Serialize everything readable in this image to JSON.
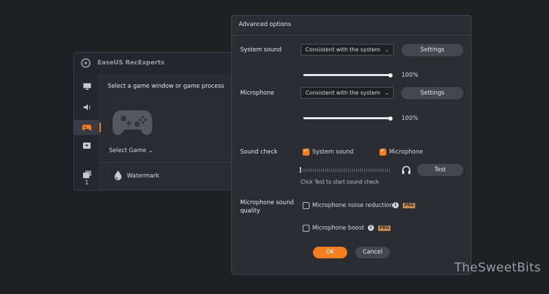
{
  "background_app": {
    "title": "EaseUS RecExperts",
    "heading": "Select a game window or game process",
    "select_game": "Select Game",
    "watermark_label": "Watermark",
    "rail_count": "1",
    "rail_icons": [
      "monitor-icon",
      "speaker-icon",
      "gamepad-icon",
      "dropdown-icon",
      "layers-icon"
    ]
  },
  "dialog": {
    "title": "Advanced options",
    "system_sound": {
      "label": "System sound",
      "select_value": "Consistent with the system",
      "settings_label": "Settings",
      "volume_pct": "100%",
      "volume": 100
    },
    "microphone": {
      "label": "Microphone",
      "select_value": "Consistent with the system",
      "settings_label": "Settings",
      "volume_pct": "100%",
      "volume": 100
    },
    "sound_check": {
      "label": "Sound check",
      "system_sound_label": "System sound",
      "system_sound_checked": true,
      "microphone_label": "Microphone",
      "microphone_checked": true,
      "test_label": "Test",
      "hint": "Click Test to start sound check"
    },
    "mic_quality": {
      "label": "Microphone sound quality",
      "noise_reduction_label": "Microphone noise reduction",
      "noise_reduction_checked": false,
      "boost_label": "Microphone boost",
      "boost_checked": false,
      "pro_badge": "PRO"
    },
    "ok_label": "OK",
    "cancel_label": "Cancel"
  },
  "site_watermark": "TheSweetBits",
  "colors": {
    "accent": "#f57c1f",
    "dialog_bg": "#2c2d33",
    "page_bg": "#1f2024"
  }
}
